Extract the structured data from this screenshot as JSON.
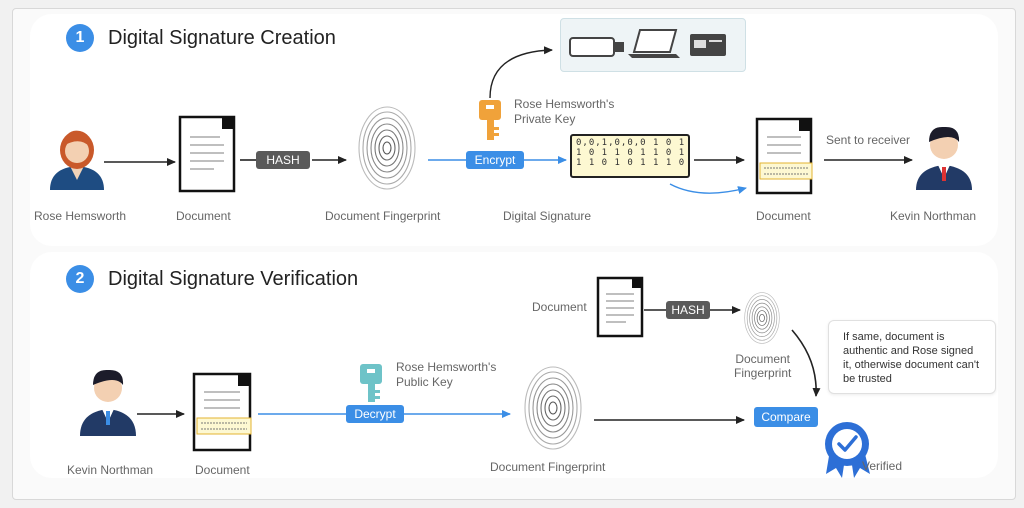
{
  "sections": {
    "creation": {
      "number": "1",
      "title": "Digital Signature Creation"
    },
    "verification": {
      "number": "2",
      "title": "Digital Signature Verification"
    }
  },
  "creation": {
    "sender_label": "Rose Hemsworth",
    "document_label": "Document",
    "hash_label": "HASH",
    "fingerprint_label": "Document Fingerprint",
    "encrypt_label": "Encrypt",
    "private_key_label": "Rose Hemsworth's\nPrivate Key",
    "signature_label": "Digital Signature",
    "signature_bits": "0,0,1,0,0,0 1 0 1 0\n1 0 1 1 0 1 1 0 1 1\n1 1 0 1 0 1 1 1 0 1 0",
    "signed_document_label": "Document",
    "sent_label": "Sent to receiver",
    "receiver_label": "Kevin Northman",
    "device_icons": [
      "usb-drive-icon",
      "laptop-icon",
      "smart-card-icon"
    ]
  },
  "verification": {
    "receiver_label": "Kevin Northman",
    "document_label": "Document",
    "decrypt_label": "Decrypt",
    "public_key_label": "Rose Hemsworth's\nPublic Key",
    "fingerprint_label": "Document Fingerprint",
    "top_document_label": "Document",
    "hash_label": "HASH",
    "top_fingerprint_label": "Document\nFingerprint",
    "compare_label": "Compare",
    "note": "If same, document is\nauthentic and Rose signed\nit, otherwise document can't\nbe trusted",
    "verified_label": "Verified"
  },
  "colors": {
    "accent": "#3b8ee6",
    "hash_pill": "#5a5a5a",
    "private_key": "#f0a23a",
    "public_key": "#6ec3c8",
    "signature_bg": "#fdf8d2"
  }
}
